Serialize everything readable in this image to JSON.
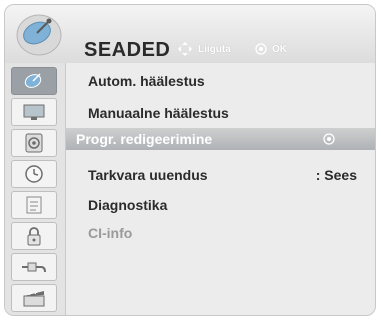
{
  "header": {
    "title": "SEADED",
    "hint_move": "Liiguta",
    "hint_ok": "OK"
  },
  "sidebar": {
    "items": [
      {
        "icon": "satellite-dish-icon",
        "active": true
      },
      {
        "icon": "tv-screen-icon",
        "active": false
      },
      {
        "icon": "speaker-icon",
        "active": false
      },
      {
        "icon": "clock-icon",
        "active": false
      },
      {
        "icon": "lock-list-icon",
        "active": false
      },
      {
        "icon": "padlock-icon",
        "active": false
      },
      {
        "icon": "plug-icon",
        "active": false
      },
      {
        "icon": "clapperboard-icon",
        "active": false
      }
    ]
  },
  "menu": {
    "items": [
      {
        "label": "Autom. häälestus",
        "value": ""
      },
      {
        "label": "Manuaalne häälestus",
        "value": ""
      },
      {
        "label": "Progr. redigeerimine",
        "value": "",
        "selected": true
      },
      {
        "label": "Tarkvara uuendus",
        "value": ": Sees"
      },
      {
        "label": "Diagnostika",
        "value": ""
      },
      {
        "label": "CI-info",
        "value": "",
        "disabled": true
      }
    ]
  },
  "colors": {
    "selected_row": "#aeb2b6",
    "disabled_text": "#9a9a9a",
    "active_sidebar": "#9aa0a6"
  }
}
